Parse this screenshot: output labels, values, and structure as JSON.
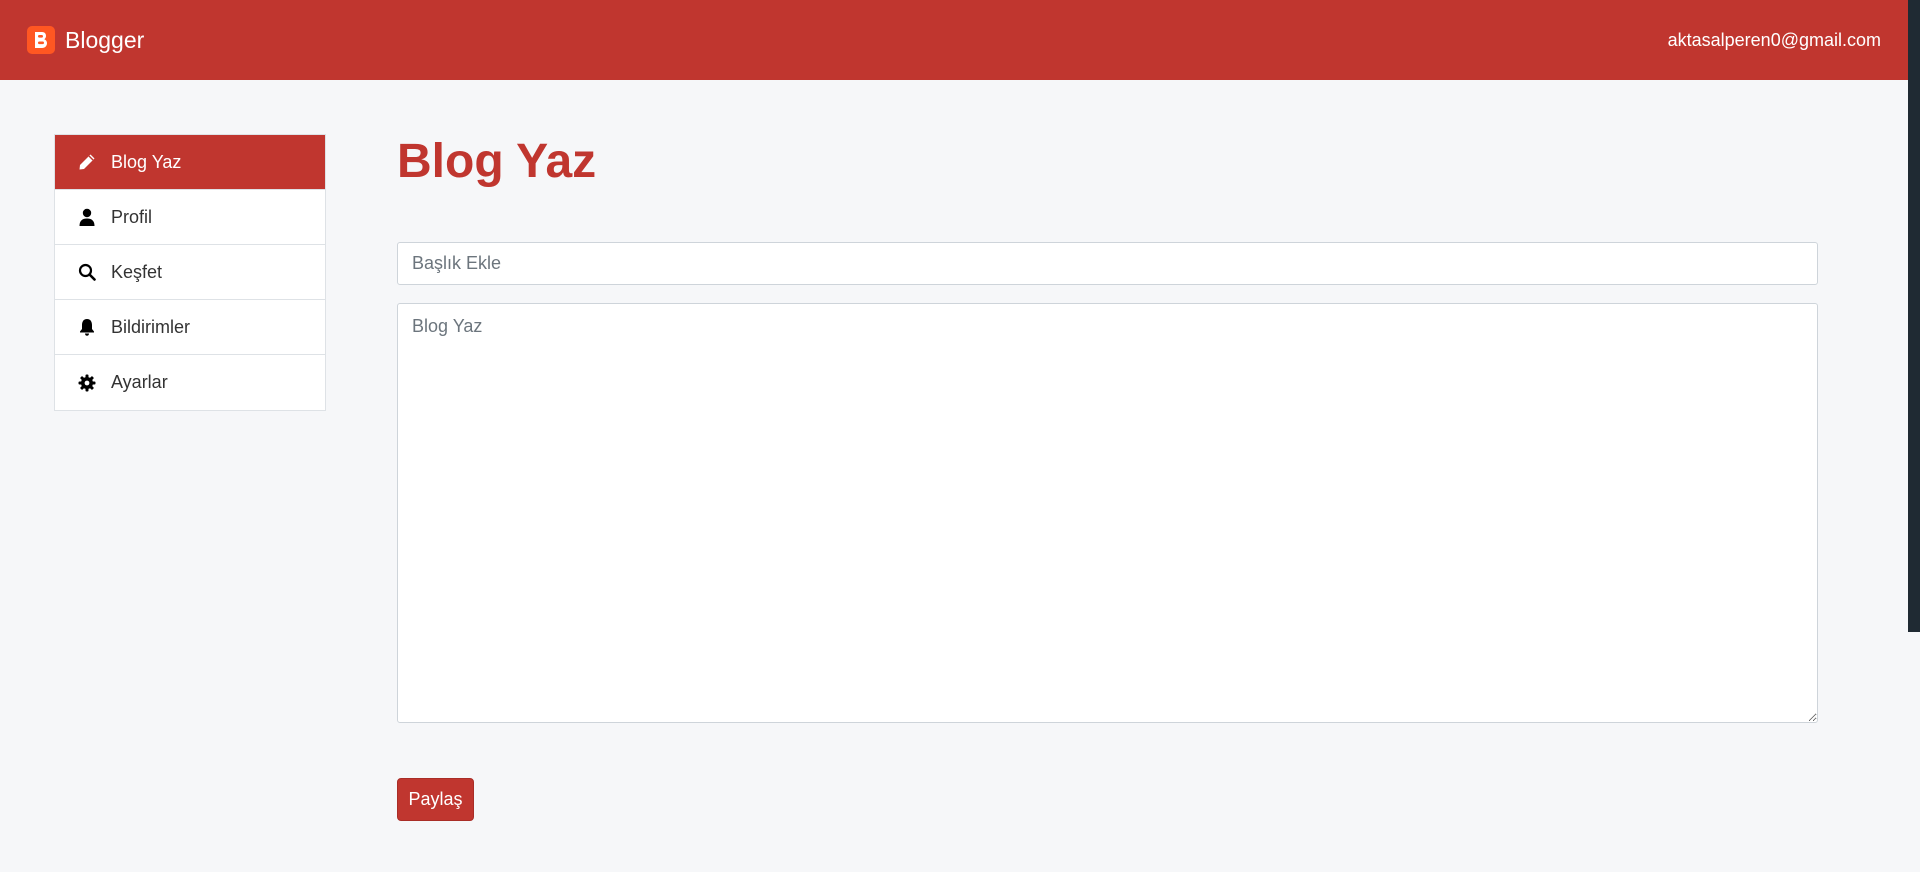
{
  "navbar": {
    "brand": "Blogger",
    "user_email": "aktasalperen0@gmail.com",
    "brand_color": "#c0362f",
    "logo_color": "#ff5722"
  },
  "sidebar": {
    "items": [
      {
        "label": "Blog Yaz",
        "icon": "pencil-icon",
        "active": true
      },
      {
        "label": "Profil",
        "icon": "user-icon",
        "active": false
      },
      {
        "label": "Keşfet",
        "icon": "search-icon",
        "active": false
      },
      {
        "label": "Bildirimler",
        "icon": "bell-icon",
        "active": false
      },
      {
        "label": "Ayarlar",
        "icon": "gear-icon",
        "active": false
      }
    ]
  },
  "main": {
    "title": "Blog Yaz",
    "title_field": {
      "placeholder": "Başlık Ekle",
      "value": ""
    },
    "body_field": {
      "placeholder": "Blog Yaz",
      "value": ""
    },
    "share_label": "Paylaş"
  }
}
